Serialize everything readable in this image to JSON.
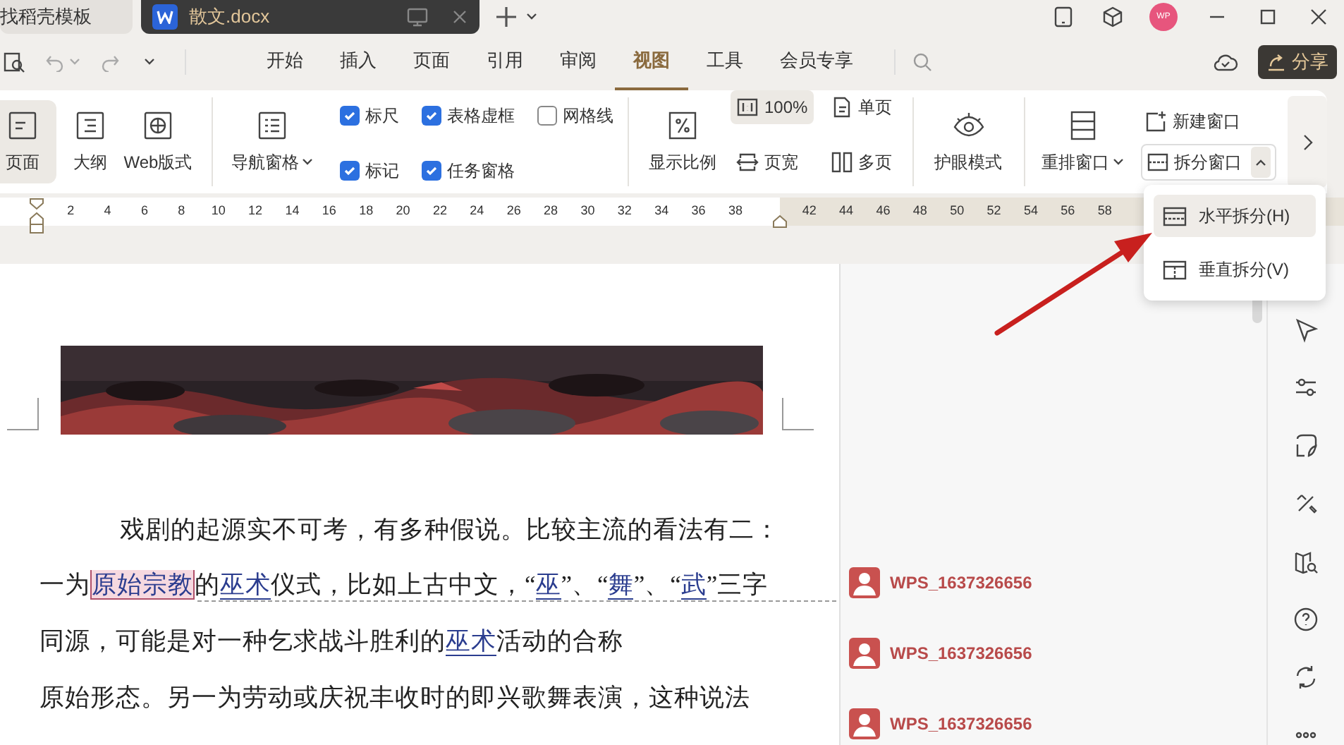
{
  "title_bar": {
    "tabs": [
      {
        "label": "找稻壳模板",
        "selected": false
      },
      {
        "label": "散文.docx",
        "selected": true
      }
    ],
    "avatar": "WP"
  },
  "menu": {
    "tabs": [
      {
        "label": "开始",
        "selected": false
      },
      {
        "label": "插入",
        "selected": false
      },
      {
        "label": "页面",
        "selected": false
      },
      {
        "label": "引用",
        "selected": false
      },
      {
        "label": "审阅",
        "selected": false
      },
      {
        "label": "视图",
        "selected": true
      },
      {
        "label": "工具",
        "selected": false
      },
      {
        "label": "会员专享",
        "selected": false
      }
    ],
    "share": "分享"
  },
  "ribbon": {
    "views": [
      {
        "label": "页面",
        "selected": true
      },
      {
        "label": "大纲",
        "selected": false
      },
      {
        "label": "Web版式",
        "selected": false
      }
    ],
    "nav_pane": "导航窗格",
    "checkboxes": [
      {
        "label": "标尺",
        "checked": true
      },
      {
        "label": "标记",
        "checked": true
      },
      {
        "label": "表格虚框",
        "checked": true
      },
      {
        "label": "任务窗格",
        "checked": true
      },
      {
        "label": "网格线",
        "checked": false
      }
    ],
    "display_ratio": "显示比例",
    "zoom_options": [
      {
        "label": "100%",
        "kind": "actual",
        "selected": true
      },
      {
        "label": "页宽",
        "kind": "width",
        "selected": false
      },
      {
        "label": "单页",
        "kind": "single",
        "selected": false
      },
      {
        "label": "多页",
        "kind": "multi",
        "selected": false
      }
    ],
    "eye_mode": "护眼模式",
    "rearrange": "重排窗口",
    "new_window": "新建窗口",
    "split_window": "拆分窗口"
  },
  "ruler": {
    "left_numbers": [
      "2",
      "4",
      "6",
      "8",
      "10",
      "12",
      "14",
      "16",
      "18",
      "20",
      "22",
      "24",
      "26",
      "28",
      "30",
      "32",
      "34",
      "36",
      "38"
    ],
    "right_numbers": [
      "42",
      "44",
      "46",
      "48",
      "50",
      "52",
      "54",
      "56",
      "58"
    ]
  },
  "split_menu": {
    "items": [
      {
        "label": "水平拆分(H)",
        "selected": true
      },
      {
        "label": "垂直拆分(V)",
        "selected": false
      }
    ]
  },
  "document": {
    "lines": [
      {
        "indented": true,
        "segments": [
          {
            "kind": "plain",
            "text": "戏剧的起源实不可考，有多种假说。比较主流的看法有二："
          }
        ]
      },
      {
        "indented": false,
        "segments": [
          {
            "kind": "plain",
            "text": "一为"
          },
          {
            "kind": "comment",
            "text": "原始宗教"
          },
          {
            "kind": "plain",
            "text": "的"
          },
          {
            "kind": "link",
            "text": "巫术"
          },
          {
            "kind": "plain",
            "text": "仪式，比如上古中文，“"
          },
          {
            "kind": "link",
            "text": "巫"
          },
          {
            "kind": "plain",
            "text": "”、“"
          },
          {
            "kind": "link",
            "text": "舞"
          },
          {
            "kind": "plain",
            "text": "”、“"
          },
          {
            "kind": "link",
            "text": "武"
          },
          {
            "kind": "plain",
            "text": "”三字"
          }
        ]
      },
      {
        "indented": false,
        "segments": [
          {
            "kind": "plain",
            "text": "同源，可能是对一种乞求战斗胜利的"
          },
          {
            "kind": "link",
            "text": "巫术"
          },
          {
            "kind": "plain",
            "text": "活动的合称"
          }
        ]
      },
      {
        "indented": false,
        "segments": [
          {
            "kind": "plain",
            "text": "原始形态。另一为劳动或庆祝丰收时的即兴歌舞表演，这种说法"
          }
        ]
      }
    ]
  },
  "comments": [
    {
      "author": "WPS_1637326656"
    },
    {
      "author": "WPS_1637326656"
    },
    {
      "author": "WPS_1637326656"
    }
  ]
}
